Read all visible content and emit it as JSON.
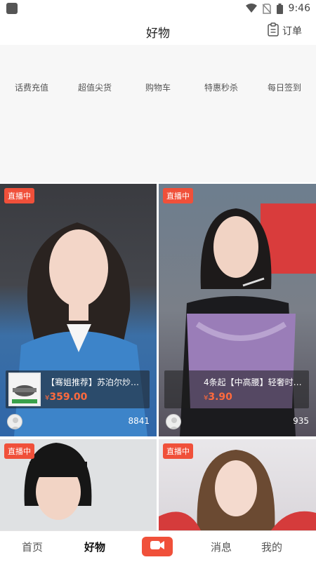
{
  "status_bar": {
    "time": "9:46"
  },
  "header": {
    "title": "好物",
    "orders_label": "订单"
  },
  "categories": [
    "话费充值",
    "超值尖货",
    "购物车",
    "特惠秒杀",
    "每日签到"
  ],
  "live_badge": "直播中",
  "cards": [
    {
      "product_title": "【骞姐推荐】苏泊尔炒锅...",
      "price_symbol": "¥",
      "price": "359.00",
      "viewers": "8841",
      "has_thumb": true
    },
    {
      "product_title": "4条起【中高腰】轻奢时尚...",
      "price_symbol": "¥",
      "price": "3.90",
      "viewers": "935",
      "has_thumb": false
    },
    {
      "live_only": true
    },
    {
      "live_only": true
    }
  ],
  "bottom_nav": {
    "home": "首页",
    "goods": "好物",
    "messages": "消息",
    "mine": "我的"
  },
  "colors": {
    "accent": "#f0503a",
    "price": "#ff6a3d"
  }
}
